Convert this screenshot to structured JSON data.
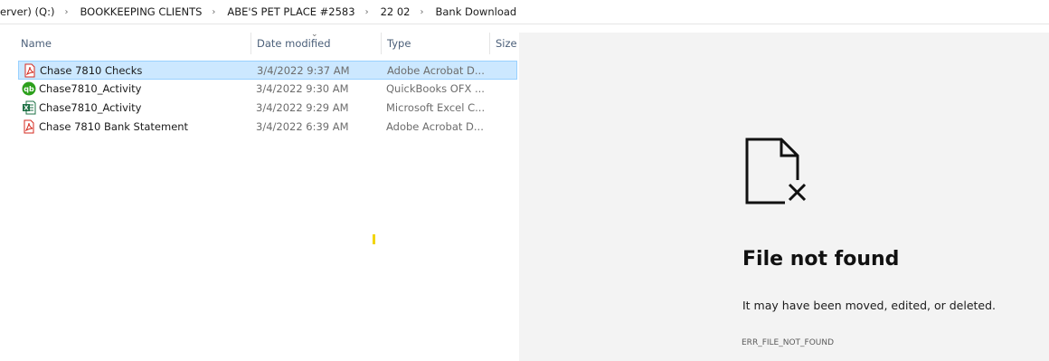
{
  "breadcrumb": {
    "items": [
      "erver) (Q:)",
      "BOOKKEEPING CLIENTS",
      "ABE'S PET PLACE #2583",
      "22 02",
      "Bank Download"
    ],
    "separator": "›"
  },
  "columns": {
    "name": "Name",
    "date": "Date modified",
    "type": "Type",
    "size": "Size"
  },
  "files": [
    {
      "name": "Chase 7810 Checks",
      "date": "3/4/2022 9:37 AM",
      "type": "Adobe Acrobat D...",
      "icon": "pdf-icon",
      "selected": true
    },
    {
      "name": "Chase7810_Activity",
      "date": "3/4/2022 9:30 AM",
      "type": "QuickBooks OFX ...",
      "icon": "quickbooks-icon",
      "selected": false
    },
    {
      "name": "Chase7810_Activity",
      "date": "3/4/2022 9:29 AM",
      "type": "Microsoft Excel C...",
      "icon": "excel-icon",
      "selected": false
    },
    {
      "name": "Chase 7810 Bank Statement",
      "date": "3/4/2022 6:39 AM",
      "type": "Adobe Acrobat D...",
      "icon": "pdf-icon",
      "selected": false
    }
  ],
  "preview": {
    "icon": "file-not-found-icon",
    "title": "File not found",
    "message": "It may have been moved, edited, or deleted.",
    "code": "ERR_FILE_NOT_FOUND"
  },
  "colors": {
    "selection_bg": "#cce8ff",
    "selection_border": "#99d1ff",
    "preview_bg": "#f3f3f3",
    "pdf_red": "#d42a1f",
    "quickbooks_green": "#2ca01c",
    "excel_green": "#1d7044"
  }
}
